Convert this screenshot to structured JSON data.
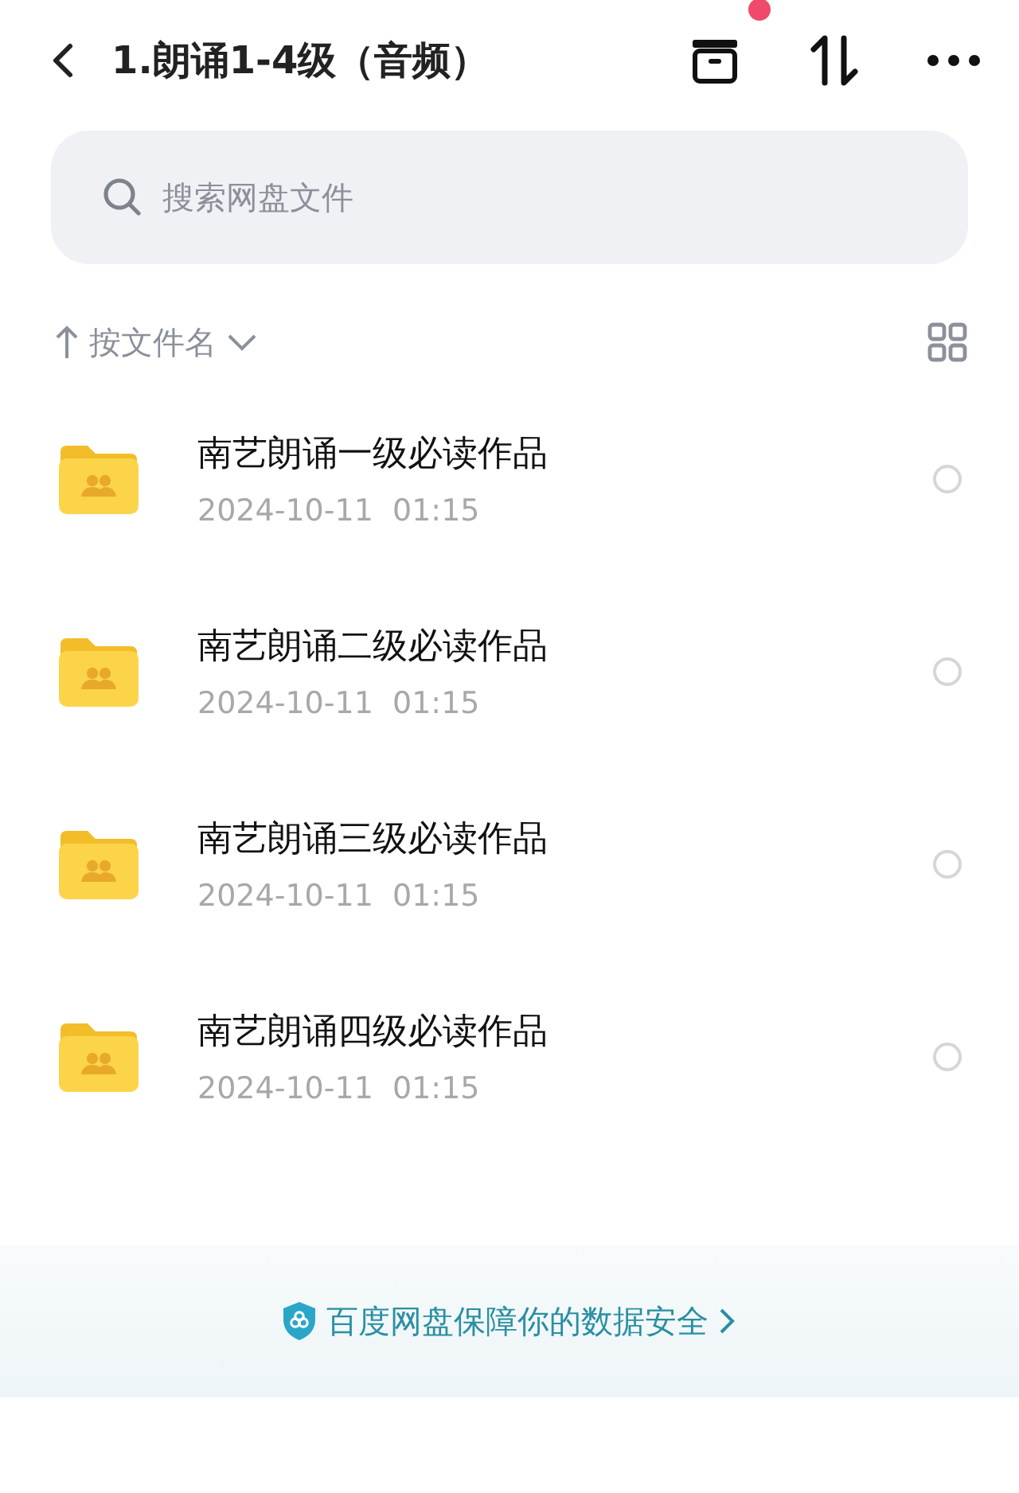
{
  "header": {
    "title": "1.朗诵1-4级（音频）",
    "has_badge": true
  },
  "search": {
    "placeholder": "搜索网盘文件"
  },
  "sort": {
    "label": "按文件名"
  },
  "files": [
    {
      "name": "南艺朗诵一级必读作品",
      "date": "2024-10-11  01:15",
      "selected": false
    },
    {
      "name": "南艺朗诵二级必读作品",
      "date": "2024-10-11  01:15",
      "selected": false
    },
    {
      "name": "南艺朗诵三级必读作品",
      "date": "2024-10-11  01:15",
      "selected": false
    },
    {
      "name": "南艺朗诵四级必读作品",
      "date": "2024-10-11  01:15",
      "selected": false
    }
  ],
  "footer": {
    "text": "百度网盘保障你的数据安全"
  }
}
